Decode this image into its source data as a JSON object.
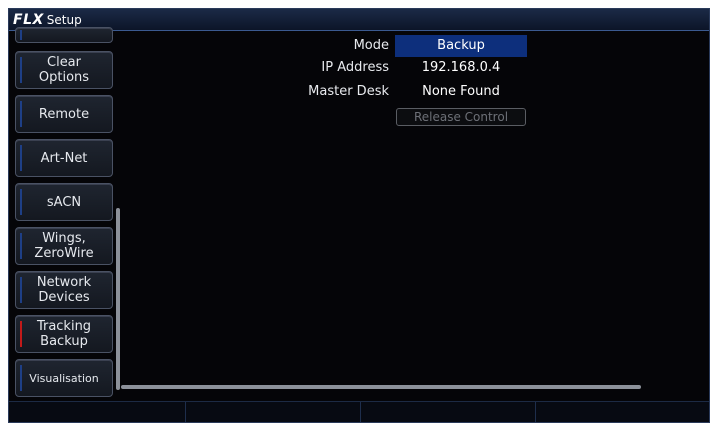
{
  "window": {
    "logo": "FLX",
    "title": "Setup"
  },
  "sidebar": {
    "items": [
      {
        "label": "",
        "active": false
      },
      {
        "label": "Clear Options",
        "active": false
      },
      {
        "label": "Remote",
        "active": false
      },
      {
        "label": "Art-Net",
        "active": false
      },
      {
        "label": "sACN",
        "active": false
      },
      {
        "label": "Wings, ZeroWire",
        "active": false
      },
      {
        "label": "Network Devices",
        "active": false
      },
      {
        "label": "Tracking Backup",
        "active": true
      },
      {
        "label": "Visualisation",
        "active": false
      }
    ]
  },
  "main": {
    "mode_label": "Mode",
    "mode_value": "Backup",
    "ip_label": "IP Address",
    "ip_value": "192.168.0.4",
    "master_label": "Master Desk",
    "master_value": "None Found",
    "release_button": "Release Control"
  },
  "colors": {
    "accent_blue": "#0d2f7c",
    "active_marker": "#c21a1a"
  }
}
